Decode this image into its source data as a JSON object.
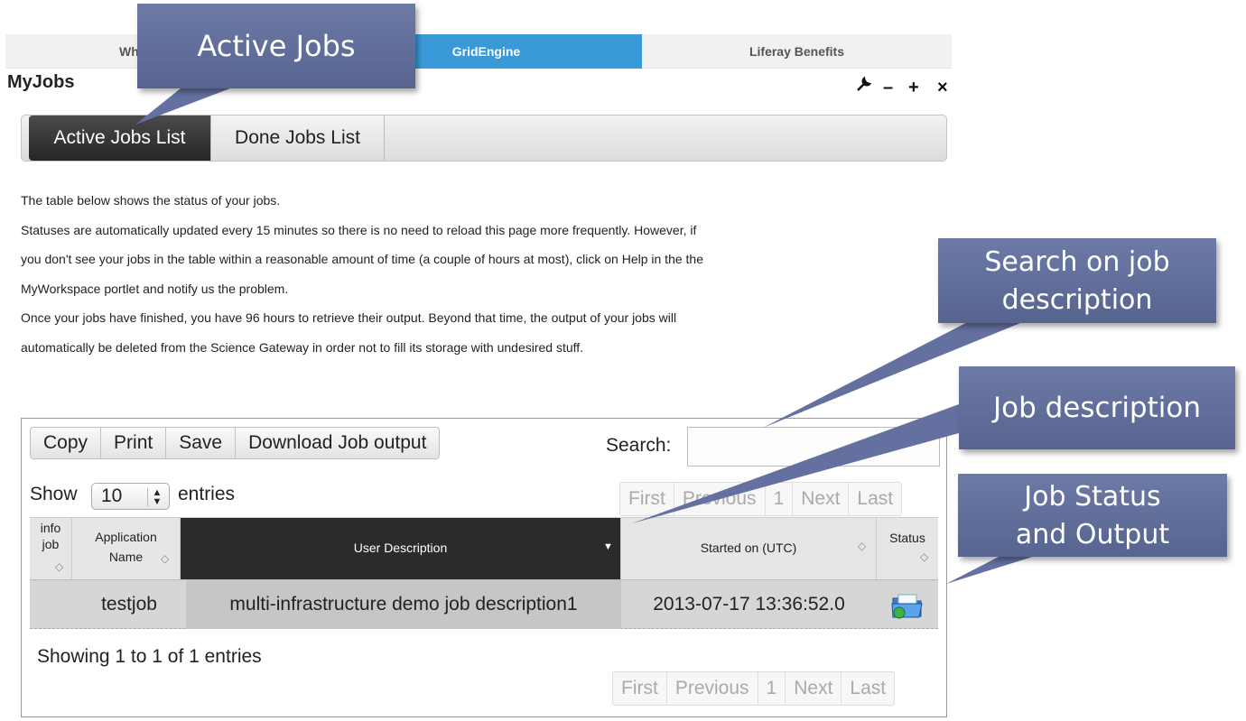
{
  "nav": {
    "item1": "Wh",
    "item2": "GridEngine",
    "item3": "Liferay Benefits",
    "active_color": "#3a9ad9"
  },
  "portlet": {
    "title": "MyJobs",
    "tools": [
      "wrench-icon",
      "minimize-icon",
      "maximize-icon",
      "close-icon"
    ]
  },
  "tabs": [
    {
      "label": "Active Jobs List",
      "active": true
    },
    {
      "label": "Done Jobs List",
      "active": false
    }
  ],
  "description": [
    "The table below shows the status of your jobs.",
    "Statuses are automatically updated every 15 minutes so there is no need to reload this page more frequently. However, if",
    "you don't see your jobs in the table within a reasonable amount of time (a couple of hours at most), click on Help in the the",
    "MyWorkspace portlet and notify us the problem.",
    "Once your jobs have finished, you have 96 hours to retrieve their output. Beyond that time, the output of your jobs will",
    "automatically be deleted from the Science Gateway in order not to fill its storage with undesired stuff."
  ],
  "table_tools": {
    "buttons": [
      "Copy",
      "Print",
      "Save",
      "Download Job output"
    ],
    "search_label": "Search:",
    "search_value": ""
  },
  "length_menu": {
    "show": "Show",
    "value": "10",
    "entries": "entries"
  },
  "pagination": [
    "First",
    "Previous",
    "1",
    "Next",
    "Last"
  ],
  "columns": {
    "info_line1": "info",
    "info_line2": "job",
    "app_line1": "Application",
    "app_line2": "Name",
    "user": "User Description",
    "started": "Started on (UTC)",
    "status": "Status"
  },
  "rows": [
    {
      "app": "testjob",
      "user": "multi-infrastructure demo job description1",
      "started": "2013-07-17 13:36:52.0",
      "status_icon": "folder-output-icon"
    }
  ],
  "info": "Showing 1 to 1 of 1 entries",
  "callouts": {
    "active_jobs": "Active Jobs",
    "search_line1": "Search on job",
    "search_line2": "description",
    "job_desc": "Job description",
    "status_line1": "Job Status",
    "status_line2": "and Output",
    "color": "#6470a0"
  }
}
